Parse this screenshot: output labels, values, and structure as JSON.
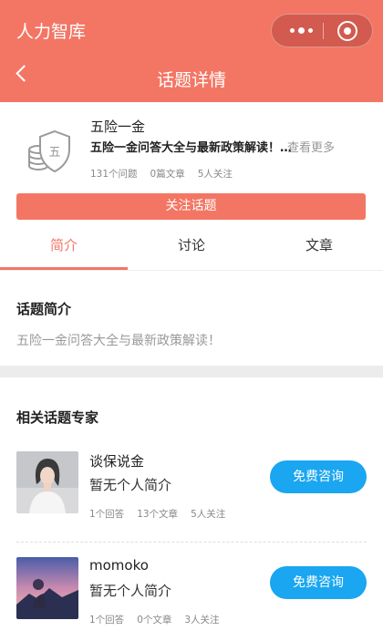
{
  "app": {
    "title": "人力智库"
  },
  "nav": {
    "title": "话题详情"
  },
  "topic": {
    "name": "五险一金",
    "description": "五险一金问答大全与最新政策解读！…",
    "see_more": "查看更多",
    "stats": [
      "131个问题",
      "0篇文章",
      "5人关注"
    ],
    "follow_label": "关注话题"
  },
  "tabs": [
    "简介",
    "讨论",
    "文章"
  ],
  "intro": {
    "title": "话题简介",
    "text": "五险一金问答大全与最新政策解读！"
  },
  "experts": {
    "title": "相关话题专家",
    "items": [
      {
        "name": "谈保说金",
        "bio": "暂无个人简介",
        "stats": [
          "1个回答",
          "13个文章",
          "5人关注"
        ],
        "consult_label": "免费咨询"
      },
      {
        "name": "momoko",
        "bio": "暂无个人简介",
        "stats": [
          "1个回答",
          "0个文章",
          "3人关注"
        ],
        "consult_label": "免费咨询"
      }
    ]
  },
  "colors": {
    "brand": "#f37664",
    "consult": "#1aa6f0",
    "muted": "#999999"
  }
}
